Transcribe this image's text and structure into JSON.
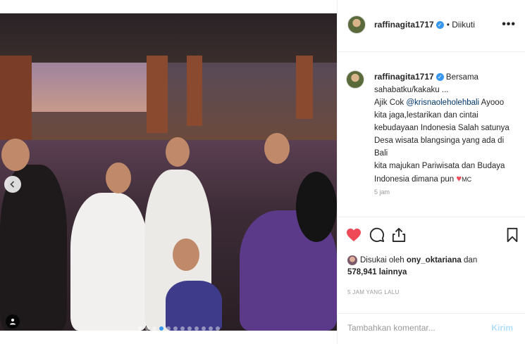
{
  "post": {
    "username": "raffinagita1717",
    "follow_status": "• Diikuti",
    "more_label": "•••",
    "caption": {
      "username": "raffinagita1717",
      "line1": "Bersama",
      "line2": "sahabatku/kakaku ...",
      "line3_pre": "Ajik Cok ",
      "mention": "@krisnaoleholehbali",
      "line3_post": " Ayooo",
      "line4": "kita jaga,lestarikan dan cintai",
      "line5": "kebudayaan Indonesia Salah satunya",
      "line6": "Desa wisata blangsinga yang ada di",
      "line7": "Bali",
      "line8": "kita majukan Pariwisata dan Budaya",
      "line9_pre": "Indonesia dimana pun ",
      "heart": "♥",
      "line9_post": "MC",
      "cut_line": "5 jam"
    },
    "likes": {
      "prefix": "Disukai oleh ",
      "liker": "ony_oktariana",
      "middle": " dan",
      "count": "578,941 lainnya"
    },
    "timestamp": "5 JAM YANG LALU",
    "comment_placeholder": "Tambahkan komentar...",
    "post_label": "Kirim"
  },
  "colors": {
    "accent": "#3897f0",
    "like_red": "#ed4956",
    "post_disabled": "#b2dffc"
  },
  "icons": [
    "chevron-left-icon",
    "user-tag-icon",
    "verified-icon",
    "heart-icon",
    "comment-icon",
    "share-icon",
    "bookmark-icon",
    "more-icon"
  ],
  "carousel": {
    "slides": 12,
    "active": 3
  }
}
